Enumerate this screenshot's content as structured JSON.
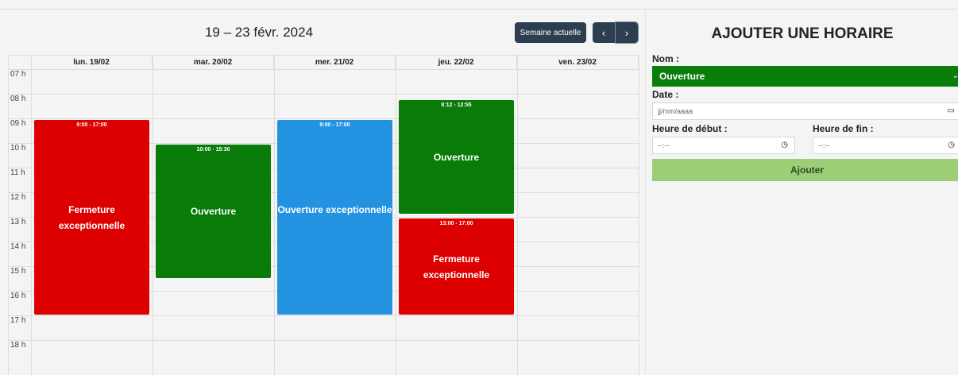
{
  "calendar": {
    "title": "19 – 23 févr. 2024",
    "current_week_label": "Semaine actuelle",
    "prev_label": "‹",
    "next_label": "›",
    "days": [
      "lun. 19/02",
      "mar. 20/02",
      "mer. 21/02",
      "jeu. 22/02",
      "ven. 23/02"
    ],
    "hours": [
      "07 h",
      "08 h",
      "09 h",
      "10 h",
      "11 h",
      "12 h",
      "13 h",
      "14 h",
      "15 h",
      "16 h",
      "17 h",
      "18 h"
    ],
    "events": [
      {
        "day": 0,
        "start": "9:00",
        "end": "17:00",
        "time": "9:00 - 17:00",
        "title": "Fermeture exceptionnelle",
        "color": "#dd0000"
      },
      {
        "day": 1,
        "start": "10:00",
        "end": "15:30",
        "time": "10:00 - 15:30",
        "title": "Ouverture",
        "color": "#087b08"
      },
      {
        "day": 2,
        "start": "9:00",
        "end": "17:00",
        "time": "9:00 - 17:00",
        "title": "Ouverture exceptionnelle",
        "color": "#2392e0"
      },
      {
        "day": 3,
        "start": "8:12",
        "end": "12:55",
        "time": "8:12 - 12:55",
        "title": "Ouverture",
        "color": "#087b08"
      },
      {
        "day": 3,
        "start": "13:00",
        "end": "17:00",
        "time": "13:00 - 17:00",
        "title": "Fermeture exceptionnelle",
        "color": "#dd0000"
      }
    ]
  },
  "form": {
    "title": "AJOUTER UNE HORAIRE",
    "name_label": "Nom :",
    "name_value": "Ouverture",
    "date_label": "Date :",
    "date_placeholder": "jj/mm/aaaa",
    "start_label": "Heure de début :",
    "end_label": "Heure de fin :",
    "time_placeholder": "--:--",
    "submit_label": "Ajouter",
    "colors": {
      "select_bg": "#0a7d0a",
      "submit_bg": "#9ccd77"
    }
  }
}
